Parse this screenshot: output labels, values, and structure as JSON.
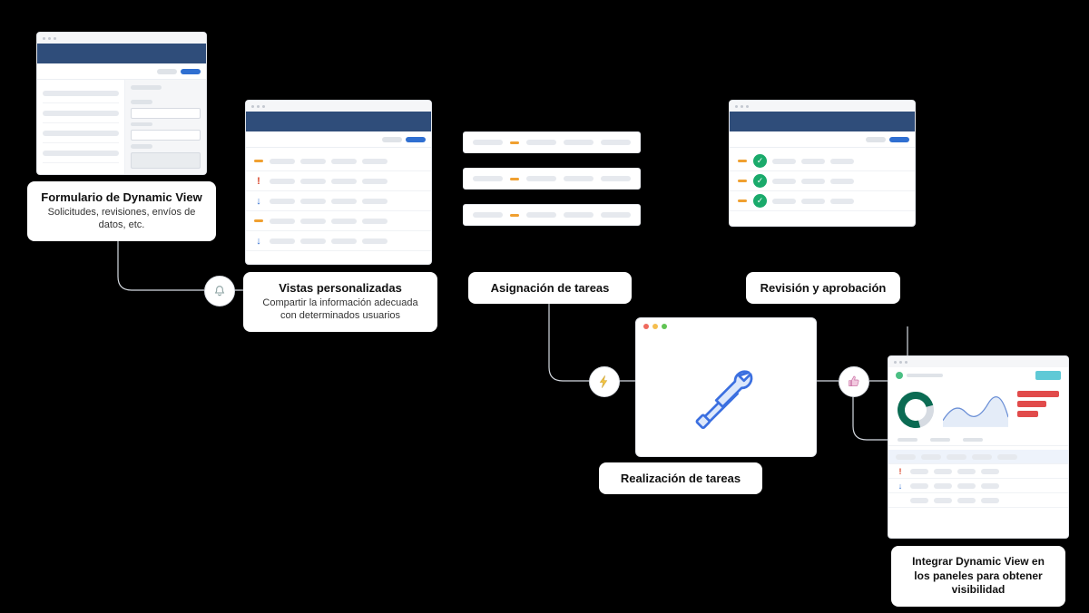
{
  "captions": {
    "form": {
      "title": "Formulario de Dynamic View",
      "sub": "Solicitudes, revisiones, envíos de datos, etc."
    },
    "views": {
      "title": "Vistas personalizadas",
      "sub": "Compartir la información adecuada con determinados usuarios"
    },
    "assign": {
      "title": "Asignación de tareas"
    },
    "review": {
      "title": "Revisión y aprobación"
    },
    "doing": {
      "title": "Realización de tareas"
    },
    "dashboard": {
      "title": "Integrar Dynamic View en los paneles para obtener visibilidad"
    }
  },
  "colors": {
    "header": "#2f4d7a",
    "accent_blue": "#2f6fd1",
    "accent_amber": "#f0a030",
    "success": "#1aaa6b",
    "alert": "#d8452a",
    "toolstroke": "#3b6fe0",
    "toolfill": "#dde8fb"
  },
  "icons": {
    "bell": "bell-icon",
    "bolt": "bolt-icon",
    "thumbs": "thumbs-up-icon",
    "tools": "tools-icon"
  }
}
